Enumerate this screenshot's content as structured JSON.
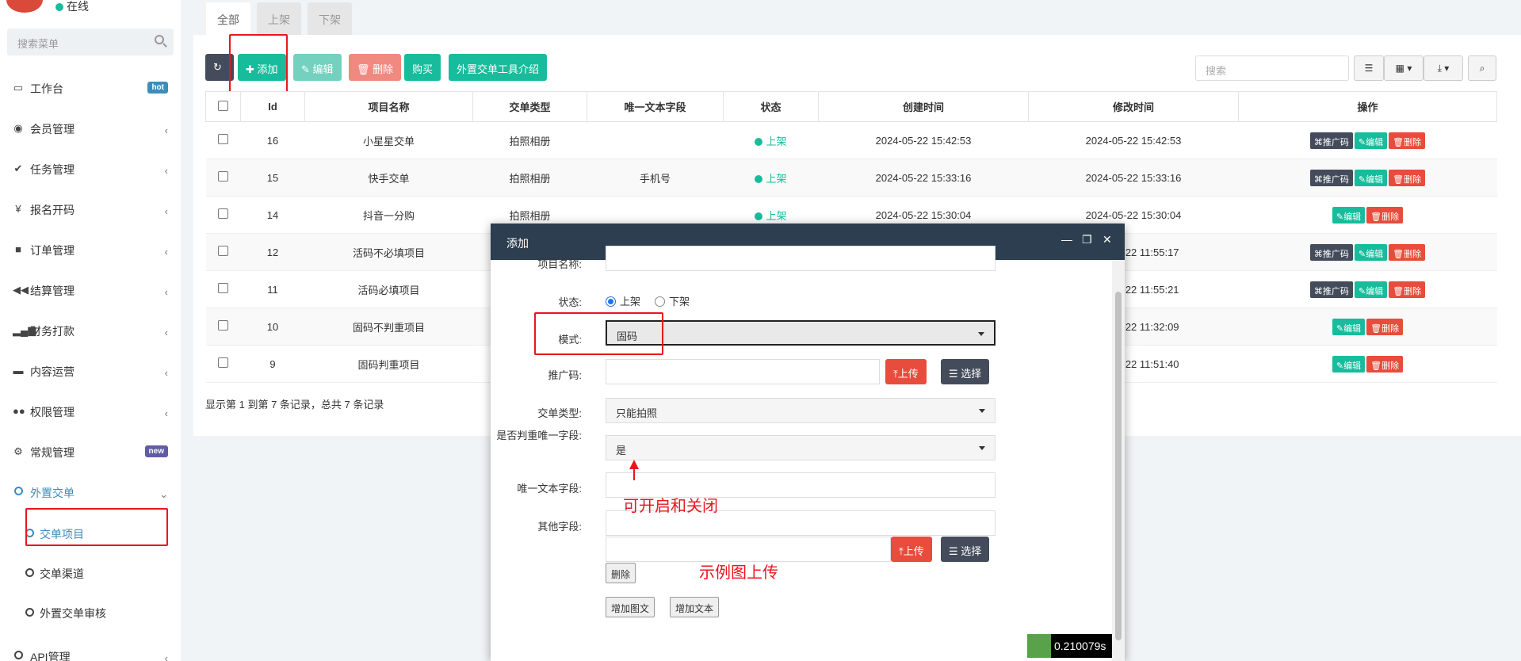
{
  "sidebar": {
    "status": "在线",
    "search_placeholder": "搜索菜单",
    "items": [
      {
        "label": "工作台",
        "badge": "hot"
      },
      {
        "label": "会员管理"
      },
      {
        "label": "任务管理"
      },
      {
        "label": "报名开码"
      },
      {
        "label": "订单管理"
      },
      {
        "label": "结算管理"
      },
      {
        "label": "财务打款"
      },
      {
        "label": "内容运营"
      },
      {
        "label": "权限管理"
      },
      {
        "label": "常规管理",
        "badge": "new"
      },
      {
        "label": "外置交单"
      }
    ],
    "sub_items": [
      {
        "label": "交单项目"
      },
      {
        "label": "交单渠道"
      },
      {
        "label": "外置交单审核"
      }
    ],
    "last_item": {
      "label": "API管理"
    }
  },
  "tabs": [
    {
      "label": "全部"
    },
    {
      "label": "上架"
    },
    {
      "label": "下架"
    }
  ],
  "toolbar": {
    "add": "添加",
    "edit": "编辑",
    "delete": "删除",
    "buy": "购买",
    "intro": "外置交单工具介绍",
    "search_placeholder": "搜索"
  },
  "table": {
    "headers": [
      "Id",
      "项目名称",
      "交单类型",
      "唯一文本字段",
      "状态",
      "创建时间",
      "修改时间",
      "操作"
    ],
    "rows": [
      {
        "id": "16",
        "name": "小星星交单",
        "type": "拍照相册",
        "unique": "",
        "status": "上架",
        "created": "2024-05-22 15:42:53",
        "modified": "2024-05-22 15:42:53",
        "promo": true
      },
      {
        "id": "15",
        "name": "快手交单",
        "type": "拍照相册",
        "unique": "手机号",
        "status": "上架",
        "created": "2024-05-22 15:33:16",
        "modified": "2024-05-22 15:33:16",
        "promo": true
      },
      {
        "id": "14",
        "name": "抖音一分购",
        "type": "拍照相册",
        "unique": "",
        "status": "上架",
        "created": "2024-05-22 15:30:04",
        "modified": "2024-05-22 15:30:04",
        "promo": false
      },
      {
        "id": "12",
        "name": "活码不必填项目",
        "type": "",
        "unique": "",
        "status": "",
        "created": "",
        "modified": "-22 11:55:17",
        "promo": true
      },
      {
        "id": "11",
        "name": "活码必填项目",
        "type": "",
        "unique": "",
        "status": "",
        "created": "",
        "modified": "-22 11:55:21",
        "promo": true
      },
      {
        "id": "10",
        "name": "固码不判重项目",
        "type": "",
        "unique": "",
        "status": "",
        "created": "",
        "modified": "-22 11:32:09",
        "promo": false
      },
      {
        "id": "9",
        "name": "固码判重项目",
        "type": "",
        "unique": "",
        "status": "",
        "created": "",
        "modified": "-22 11:51:40",
        "promo": false
      }
    ],
    "row_actions": {
      "promo": "推广码",
      "edit": "编辑",
      "delete": "删除"
    },
    "summary": "显示第 1 到第 7 条记录，总共 7 条记录"
  },
  "modal": {
    "title": "添加",
    "fields": {
      "name_label": "项目名称:",
      "status_label": "状态:",
      "status_on": "上架",
      "status_off": "下架",
      "mode_label": "模式:",
      "mode_value": "固码",
      "promo_label": "推广码:",
      "type_label": "交单类型:",
      "type_value": "只能拍照",
      "dedupe_label": "是否判重唯一字段:",
      "dedupe_value": "是",
      "unique_label": "唯一文本字段:",
      "other_label": "其他字段:"
    },
    "upload": "上传",
    "choose": "选择",
    "remove": "删除",
    "add_image_text": "增加图文",
    "add_text": "增加文本"
  },
  "annotations": {
    "toggle_note": "可开启和关闭",
    "sample_note": "示例图上传"
  },
  "debug_timer": "0.210079s"
}
